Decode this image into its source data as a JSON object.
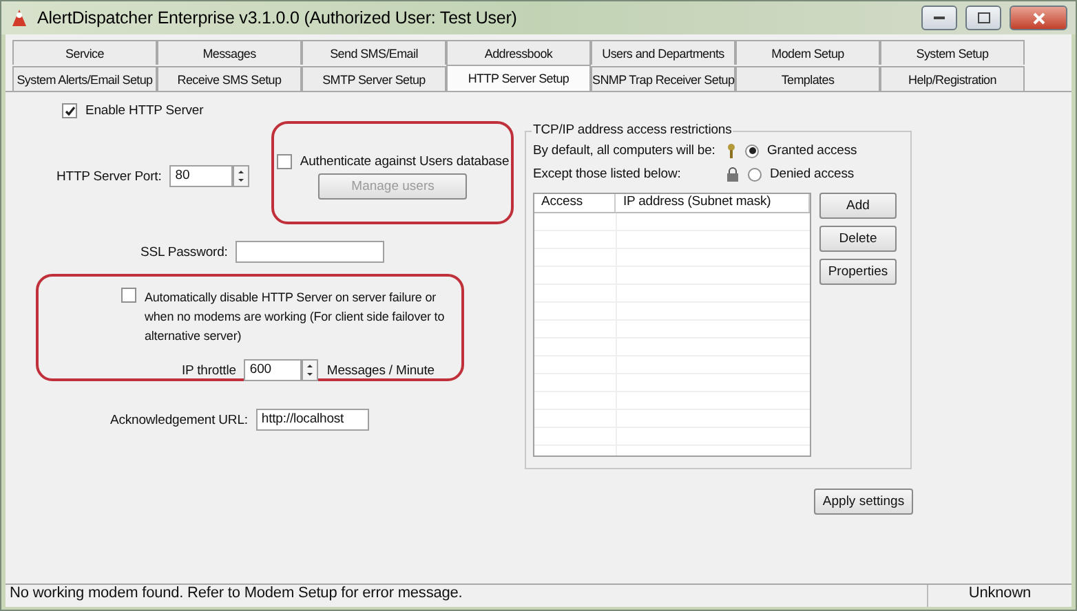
{
  "window": {
    "title": "AlertDispatcher Enterprise v3.1.0.0 (Authorized User: Test User)"
  },
  "tab_rows": [
    [
      {
        "label": "Service",
        "selected": false
      },
      {
        "label": "Messages",
        "selected": false
      },
      {
        "label": "Send SMS/Email",
        "selected": false
      },
      {
        "label": "Addressbook",
        "selected": false
      },
      {
        "label": "Users and Departments",
        "selected": false
      },
      {
        "label": "Modem Setup",
        "selected": false
      },
      {
        "label": "System Setup",
        "selected": false
      }
    ],
    [
      {
        "label": "System Alerts/Email Setup",
        "selected": false
      },
      {
        "label": "Receive SMS Setup",
        "selected": false
      },
      {
        "label": "SMTP Server Setup",
        "selected": false
      },
      {
        "label": "HTTP Server Setup",
        "selected": true
      },
      {
        "label": "SNMP Trap Receiver Setup",
        "selected": false
      },
      {
        "label": "Templates",
        "selected": false
      },
      {
        "label": "Help/Registration",
        "selected": false
      }
    ]
  ],
  "enable_http": {
    "label": "Enable HTTP Server",
    "checked": true
  },
  "port": {
    "label": "HTTP Server Port:",
    "value": "80"
  },
  "auth": {
    "label": "Authenticate against Users database",
    "checked": false,
    "button": "Manage users",
    "button_disabled": true
  },
  "ssl": {
    "label": "SSL Password:"
  },
  "auto_disable": {
    "label": "Automatically disable HTTP Server on server failure or when no modems are working (For client side failover to alternative server)",
    "checked": false
  },
  "throttle": {
    "label": "IP throttle",
    "value": "600",
    "unit": "Messages / Minute"
  },
  "ack": {
    "label": "Acknowledgement URL:",
    "value": "http://localhost"
  },
  "access": {
    "title": "TCP/IP address access restrictions",
    "default_label": "By default, all computers will be:",
    "except_label": "Except those listed below:",
    "options": [
      {
        "label": "Granted access",
        "selected": true
      },
      {
        "label": "Denied access",
        "selected": false
      }
    ],
    "columns": [
      "Access",
      "IP address (Subnet mask)"
    ],
    "buttons": [
      "Add",
      "Delete",
      "Properties"
    ]
  },
  "apply": "Apply settings",
  "status_bar": {
    "message": "No working modem found. Refer to Modem Setup for error message.",
    "state": "Unknown"
  }
}
